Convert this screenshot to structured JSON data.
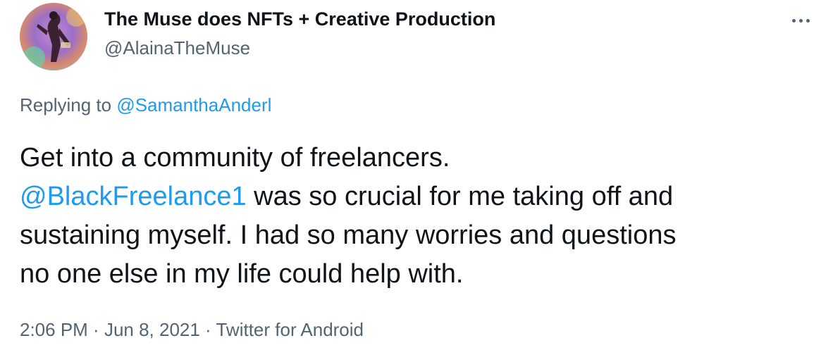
{
  "author": {
    "display_name": "The Muse does NFTs + Creative Production",
    "handle": "@AlainaTheMuse"
  },
  "reply": {
    "prefix": "Replying to ",
    "to_handle": "@SamanthaAnderl"
  },
  "tweet": {
    "line1": "Get into a community of freelancers.",
    "mention": "@BlackFreelance1",
    "line2_rest": " was so crucial for me taking off and",
    "line3": "sustaining myself. I had so many worries and questions",
    "line4": "no one else in my life could help with."
  },
  "meta": {
    "time": "2:06 PM",
    "separator1": " · ",
    "date": "Jun 8, 2021",
    "separator2": " · ",
    "source": "Twitter for Android"
  },
  "colors": {
    "link": "#1d9bf0",
    "secondary_text": "#536471",
    "primary_text": "#0f1419"
  },
  "icons": {
    "more": "more-horizontal-icon"
  }
}
